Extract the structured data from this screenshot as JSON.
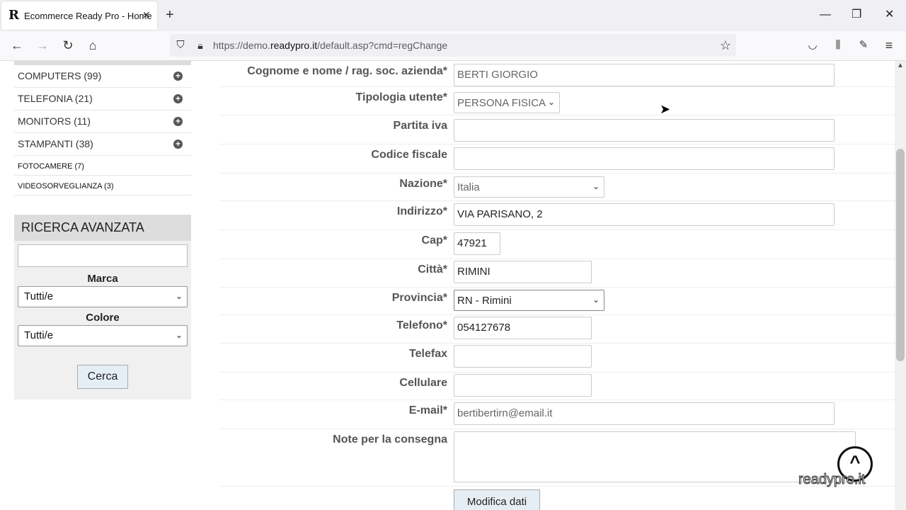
{
  "browser": {
    "tab_title": "Ecommerce Ready Pro - Home",
    "url_prefix": "https://demo.",
    "url_domain": "readypro.it",
    "url_path": "/default.asp?cmd=regChange"
  },
  "sidebar": {
    "categories": [
      {
        "label": "COMPUTERS (99)"
      },
      {
        "label": "TELEFONIA (21)"
      },
      {
        "label": "MONITORS (11)"
      },
      {
        "label": "STAMPANTI (38)"
      },
      {
        "label": "FOTOCAMERE (7)"
      },
      {
        "label": "VIDEOSORVEGLIANZA (3)"
      }
    ],
    "search": {
      "title": "RICERCA AVANZATA",
      "marca_label": "Marca",
      "marca_value": "Tutti/e",
      "colore_label": "Colore",
      "colore_value": "Tutti/e",
      "button": "Cerca"
    }
  },
  "form": {
    "nome_label": "Cognome e nome / rag. soc. azienda*",
    "nome_value": "BERTI GIORGIO",
    "tipologia_label": "Tipologia utente*",
    "tipologia_value": "PERSONA FISICA",
    "piva_label": "Partita iva",
    "cf_label": "Codice fiscale",
    "nazione_label": "Nazione*",
    "nazione_value": "Italia",
    "indirizzo_label": "Indirizzo*",
    "indirizzo_value": "VIA PARISANO, 2",
    "cap_label": "Cap*",
    "cap_value": "47921",
    "citta_label": "Città*",
    "citta_value": "RIMINI",
    "provincia_label": "Provincia*",
    "provincia_value": "RN - Rimini",
    "telefono_label": "Telefono*",
    "telefono_value": "054127678",
    "telefax_label": "Telefax",
    "cellulare_label": "Cellulare",
    "email_label": "E-mail*",
    "email_value": "bertibertirn@email.it",
    "note_label": "Note per la consegna",
    "submit": "Modifica dati"
  },
  "brand_logo": "readypro.it"
}
